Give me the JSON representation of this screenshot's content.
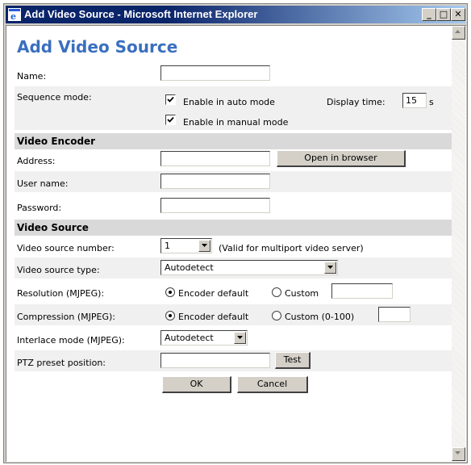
{
  "window": {
    "title": "Add Video Source - Microsoft Internet Explorer",
    "min_label": "_",
    "max_label": "□",
    "close_label": "✕"
  },
  "page": {
    "title": "Add Video Source"
  },
  "general": {
    "name_label": "Name:",
    "name_value": "",
    "sequence_label": "Sequence mode:",
    "auto_mode_label": "Enable in auto mode",
    "auto_mode_checked": true,
    "display_time_label": "Display time:",
    "display_time_value": "15",
    "display_time_unit": "s",
    "manual_mode_label": "Enable in manual mode",
    "manual_mode_checked": true
  },
  "encoder": {
    "section_title": "Video Encoder",
    "address_label": "Address:",
    "address_value": "",
    "open_browser_label": "Open in browser",
    "username_label": "User name:",
    "username_value": "",
    "password_label": "Password:",
    "password_value": ""
  },
  "source": {
    "section_title": "Video Source",
    "number_label": "Video source number:",
    "number_value": "1",
    "number_note": "(Valid for multiport video server)",
    "type_label": "Video source type:",
    "type_value": "Autodetect",
    "resolution_label": "Resolution (MJPEG):",
    "resolution_default_label": "Encoder default",
    "resolution_custom_label": "Custom",
    "resolution_custom_value": "",
    "compression_label": "Compression (MJPEG):",
    "compression_default_label": "Encoder default",
    "compression_custom_label": "Custom (0-100)",
    "compression_custom_value": "",
    "interlace_label": "Interlace mode (MJPEG):",
    "interlace_value": "Autodetect",
    "ptz_label": "PTZ preset position:",
    "ptz_value": "",
    "test_label": "Test"
  },
  "actions": {
    "ok_label": "OK",
    "cancel_label": "Cancel"
  }
}
